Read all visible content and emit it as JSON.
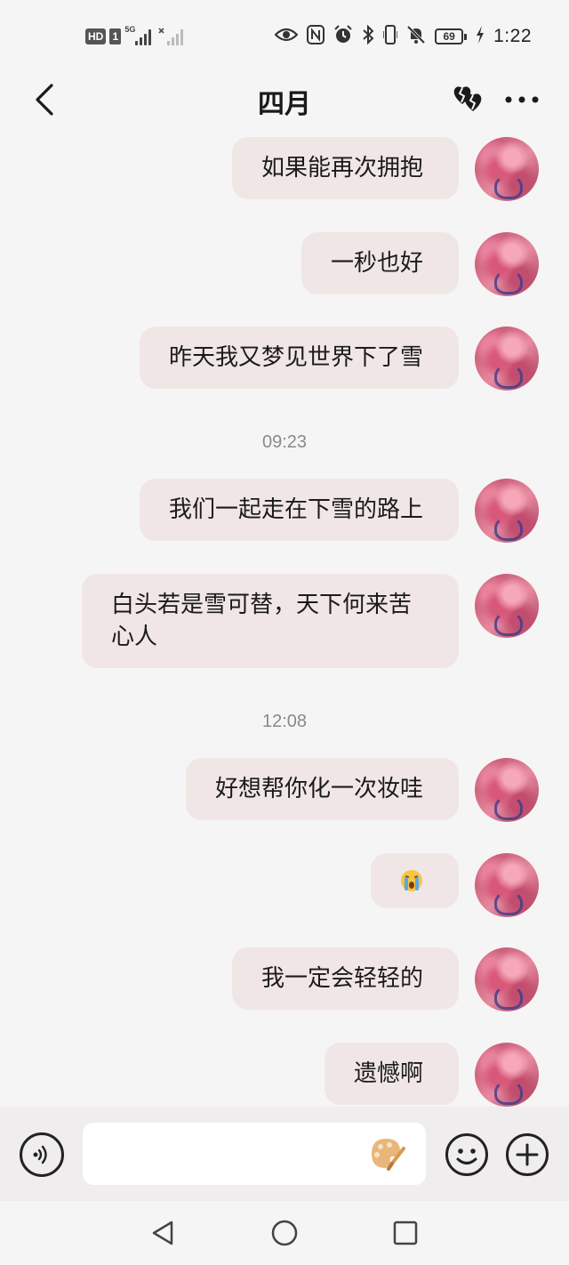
{
  "status_bar": {
    "hd_label": "HD",
    "sim_label": "1",
    "network_label": "5G",
    "battery_level": "69",
    "time": "1:22",
    "icons": [
      "eye-icon",
      "nfc-icon",
      "alarm-icon",
      "bluetooth-icon",
      "vibrate-icon",
      "mute-bell-icon",
      "battery-icon",
      "charging-icon"
    ]
  },
  "header": {
    "title": "四月",
    "back_icon": "chevron-left-icon",
    "hearts_icon": "broken-hearts-icon",
    "more_icon": "more-dots-icon"
  },
  "messages": [
    {
      "type": "outgoing",
      "text": "如果能再次拥抱"
    },
    {
      "type": "outgoing",
      "text": "一秒也好"
    },
    {
      "type": "outgoing",
      "text": "昨天我又梦见世界下了雪"
    },
    {
      "type": "timestamp",
      "text": "09:23"
    },
    {
      "type": "outgoing",
      "text": "我们一起走在下雪的路上"
    },
    {
      "type": "outgoing",
      "text": "白头若是雪可替，天下何来苦心人"
    },
    {
      "type": "timestamp",
      "text": "12:08"
    },
    {
      "type": "outgoing",
      "text": "好想帮你化一次妆哇"
    },
    {
      "type": "outgoing",
      "emoji": "crying-face-emoji"
    },
    {
      "type": "outgoing",
      "text": "我一定会轻轻的"
    },
    {
      "type": "outgoing",
      "text": "遗憾啊"
    }
  ],
  "input_bar": {
    "placeholder": "",
    "value": "",
    "voice_icon": "voice-icon",
    "palette_icon": "palette-icon",
    "emoji_icon": "smiley-icon",
    "plus_icon": "plus-circle-icon"
  },
  "nav_bar": {
    "icons": [
      "back-triangle-icon",
      "home-circle-icon",
      "recents-square-icon"
    ]
  },
  "colors": {
    "background": "#f6f5f5",
    "bubble": "#f1e6e6",
    "input_bar": "#efeded",
    "timestamp": "#8a8a8a",
    "text": "#1b1b1b"
  }
}
